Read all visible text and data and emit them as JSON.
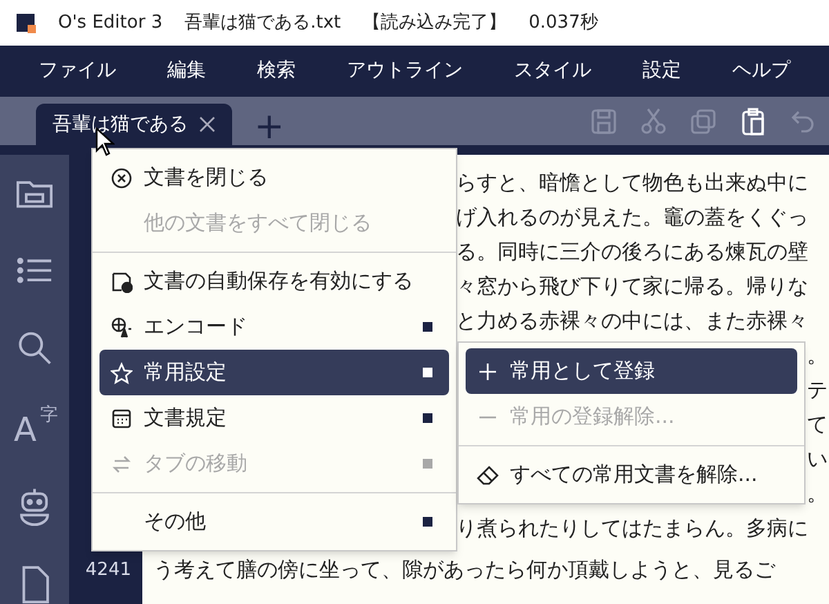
{
  "window": {
    "title_parts": [
      "O's Editor 3",
      "吾輩は猫である.txt",
      "【読み込み完了】",
      "0.037秒"
    ]
  },
  "menu_bar": [
    "ファイル",
    "編集",
    "検索",
    "アウトライン",
    "スタイル",
    "設定",
    "ヘルプ"
  ],
  "tabs": [
    {
      "label": "吾輩は猫である",
      "selected": true
    }
  ],
  "new_tab": "+",
  "toolbar": [
    {
      "kind": "save",
      "disabled": true
    },
    {
      "kind": "cut",
      "disabled": true
    },
    {
      "kind": "copy",
      "disabled": true
    },
    {
      "kind": "paste",
      "disabled": false
    },
    {
      "kind": "undo",
      "disabled": true
    }
  ],
  "sidebar": [
    {
      "kind": "folder"
    },
    {
      "kind": "list"
    },
    {
      "kind": "search"
    },
    {
      "kind": "font",
      "label": "A",
      "sup": "字"
    },
    {
      "kind": "robot"
    },
    {
      "kind": "document"
    }
  ],
  "editor_lines": [
    {
      "kind": "after_menu",
      "text": "らすと、暗憺として物色も出来ぬ中に"
    },
    {
      "kind": "after_menu",
      "text": "げ入れるのが見えた。竈の蓋をくぐっ"
    },
    {
      "kind": "after_menu",
      "text": "る。同時に三介の後ろにある煉瓦の壁"
    },
    {
      "kind": "after_menu",
      "text": "々窓から飛び下りて家に帰る。帰りな"
    },
    {
      "kind": "after_menu",
      "text": "と力める赤裸々の中には、また赤裸々"
    },
    {
      "kind": "after_submenu",
      "text": "。"
    },
    {
      "kind": "after_submenu",
      "text": "テ"
    },
    {
      "kind": "after_submenu",
      "text": "て"
    },
    {
      "kind": "after_submenu",
      "text": "い"
    },
    {
      "kind": "after_submenu",
      "text": "。"
    },
    {
      "kind": "after_menu",
      "text": "り煮られたりしてはたまらん。多病に"
    },
    {
      "kind": "full",
      "line_number": "4241",
      "text": "う考えて膳の傍に坐って、隙があったら何か頂戴しようと、見るご"
    }
  ],
  "context_menu": [
    {
      "kind": "item",
      "label": "文書を閉じる",
      "disabled": false,
      "selected": false,
      "submenu": false
    },
    {
      "kind": "item",
      "label": "他の文書をすべて閉じる",
      "disabled": true,
      "selected": false,
      "submenu": false
    },
    {
      "kind": "separator"
    },
    {
      "kind": "item",
      "label": "文書の自動保存を有効にする",
      "disabled": false,
      "selected": false,
      "submenu": false
    },
    {
      "kind": "item",
      "label": "エンコード",
      "disabled": false,
      "selected": false,
      "submenu": true
    },
    {
      "kind": "item",
      "label": "常用設定",
      "disabled": false,
      "selected": true,
      "submenu": true
    },
    {
      "kind": "item",
      "label": "文書規定",
      "disabled": false,
      "selected": false,
      "submenu": true
    },
    {
      "kind": "item",
      "label": "タブの移動",
      "disabled": true,
      "selected": false,
      "submenu": true
    },
    {
      "kind": "separator"
    },
    {
      "kind": "item",
      "label": "その他",
      "disabled": false,
      "selected": false,
      "submenu": true
    }
  ],
  "submenu": [
    {
      "kind": "item",
      "label": "常用として登録",
      "disabled": false,
      "selected": true
    },
    {
      "kind": "item",
      "label": "常用の登録解除...",
      "disabled": true,
      "selected": false
    },
    {
      "kind": "separator"
    },
    {
      "kind": "item",
      "label": "すべての常用文書を解除...",
      "disabled": false,
      "selected": false
    }
  ]
}
